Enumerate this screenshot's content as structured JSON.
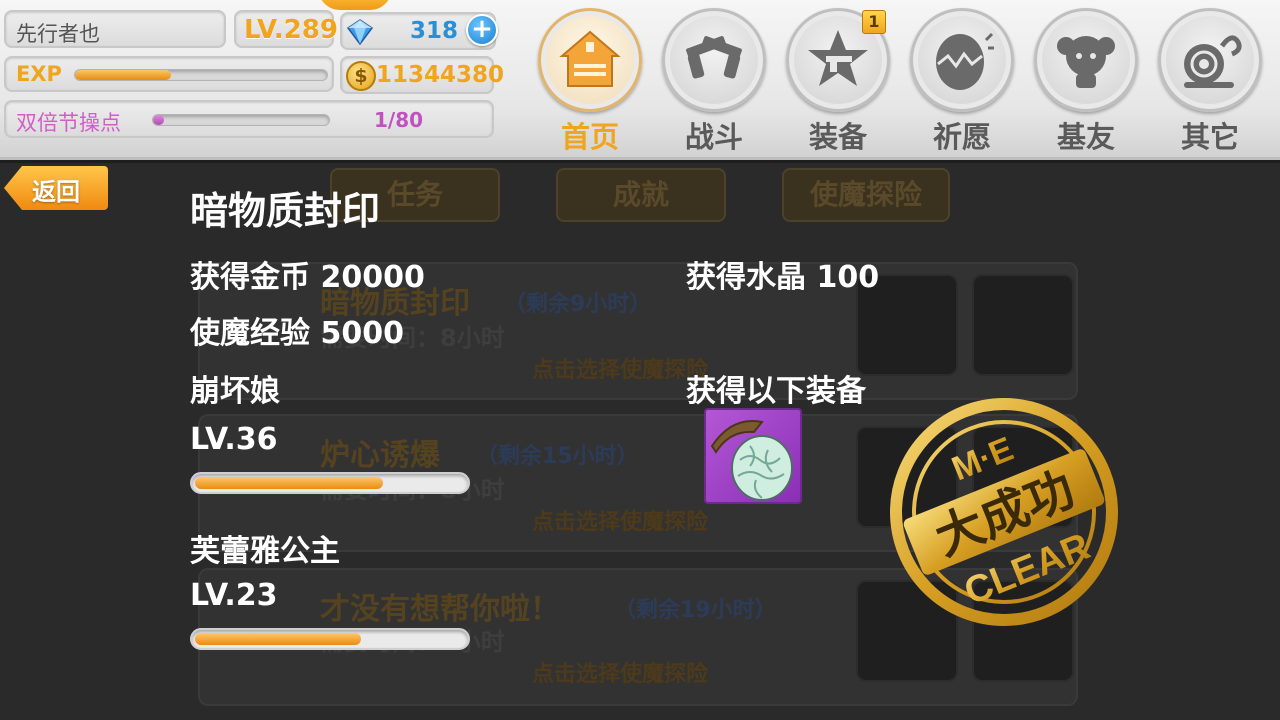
{
  "player": {
    "name": "先行者也",
    "level": "LV.289",
    "exp_label": "EXP",
    "exp_progress": 0.38,
    "crystals": "318",
    "gold": "11344380",
    "double_event_label": "双倍节操点",
    "double_event_count": "1/80",
    "double_event_progress": 0.02
  },
  "nav": {
    "items": [
      {
        "label": "首页",
        "icon": "house-icon",
        "active": true
      },
      {
        "label": "战斗",
        "icon": "crossed-guns-icon"
      },
      {
        "label": "装备",
        "icon": "star-gun-icon",
        "badge": "1"
      },
      {
        "label": "祈愿",
        "icon": "cracked-egg-icon"
      },
      {
        "label": "基友",
        "icon": "friend-face-icon"
      },
      {
        "label": "其它",
        "icon": "snail-icon"
      }
    ]
  },
  "background": {
    "tabs": [
      "任务",
      "成就",
      "使魔探险"
    ],
    "missions": [
      {
        "title": "暗物质封印",
        "remaining": "（剩余9小时）",
        "time": "需要时间：8小时",
        "action": "点击选择使魔探险"
      },
      {
        "title": "炉心诱爆",
        "remaining": "（剩余15小时）",
        "time": "需要时间：8小时",
        "action": "点击选择使魔探险"
      },
      {
        "title": "才没有想帮你啦！",
        "remaining": "（剩余19小时）",
        "time": "需要时间：9小时",
        "action": "点击选择使魔探险"
      }
    ]
  },
  "result": {
    "back_label": "返回",
    "title": "暗物质封印",
    "gold_reward": "获得金币 20000",
    "crystal_reward": "获得水晶 100",
    "familiar_exp": "使魔经验 5000",
    "equipment_label": "获得以下装备",
    "equipment_icon": "egg-pouch-icon",
    "familiars": [
      {
        "name": "崩坏娘",
        "level": "LV.36",
        "progress": 0.68
      },
      {
        "name": "芙蕾雅公主",
        "level": "LV.23",
        "progress": 0.6
      }
    ],
    "stamp": {
      "top": "M·E",
      "middle": "大成功",
      "bottom": "CLEAR"
    }
  },
  "colors": {
    "accent_orange": "#f0a51e",
    "crystal_blue": "#2a8fd6",
    "event_purple": "#d35cc8",
    "stamp_gold": "#e1b73a"
  }
}
